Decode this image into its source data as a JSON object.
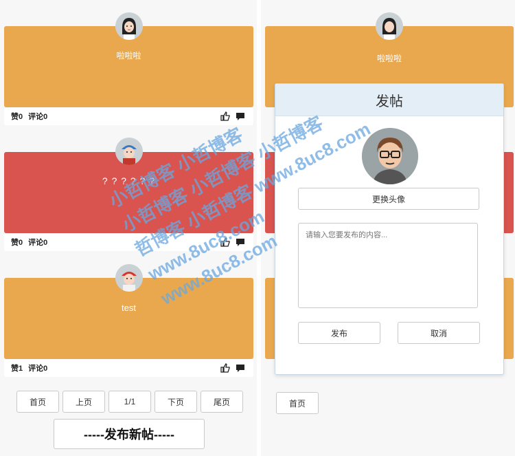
{
  "posts": [
    {
      "text": "啦啦啦",
      "color": "#e9a84d",
      "likes": "赞0",
      "comments": "评论0",
      "avatar": "girl-avatar"
    },
    {
      "text": "? ? ? ? ? ?",
      "color": "#d9534f",
      "likes": "赞0",
      "comments": "评论0",
      "avatar": "boy-cap-avatar"
    },
    {
      "text": "test",
      "color": "#e9a84d",
      "likes": "赞1",
      "comments": "评论0",
      "avatar": "boy-redcap-avatar"
    }
  ],
  "right_post": {
    "text": "啦啦啦",
    "color": "#e9a84d"
  },
  "pagination": {
    "first": "首页",
    "prev": "上页",
    "page": "1/1",
    "next": "下页",
    "last": "尾页"
  },
  "publish_button": "-----发布新帖-----",
  "modal": {
    "title": "发帖",
    "change_avatar": "更换头像",
    "placeholder": "请输入您要发布的内容...",
    "submit": "发布",
    "cancel": "取消"
  },
  "watermark": {
    "lines": [
      "小哲博客 小哲博客",
      "小哲博客 小哲博客 小哲博客",
      "哲博客 小哲博客 www.8uc8.com",
      "www.8uc8.com",
      "www.8uc8.com"
    ]
  },
  "colors": {
    "orange": "#e9a84d",
    "red": "#d9534f",
    "modal_header": "#e4eef7"
  }
}
